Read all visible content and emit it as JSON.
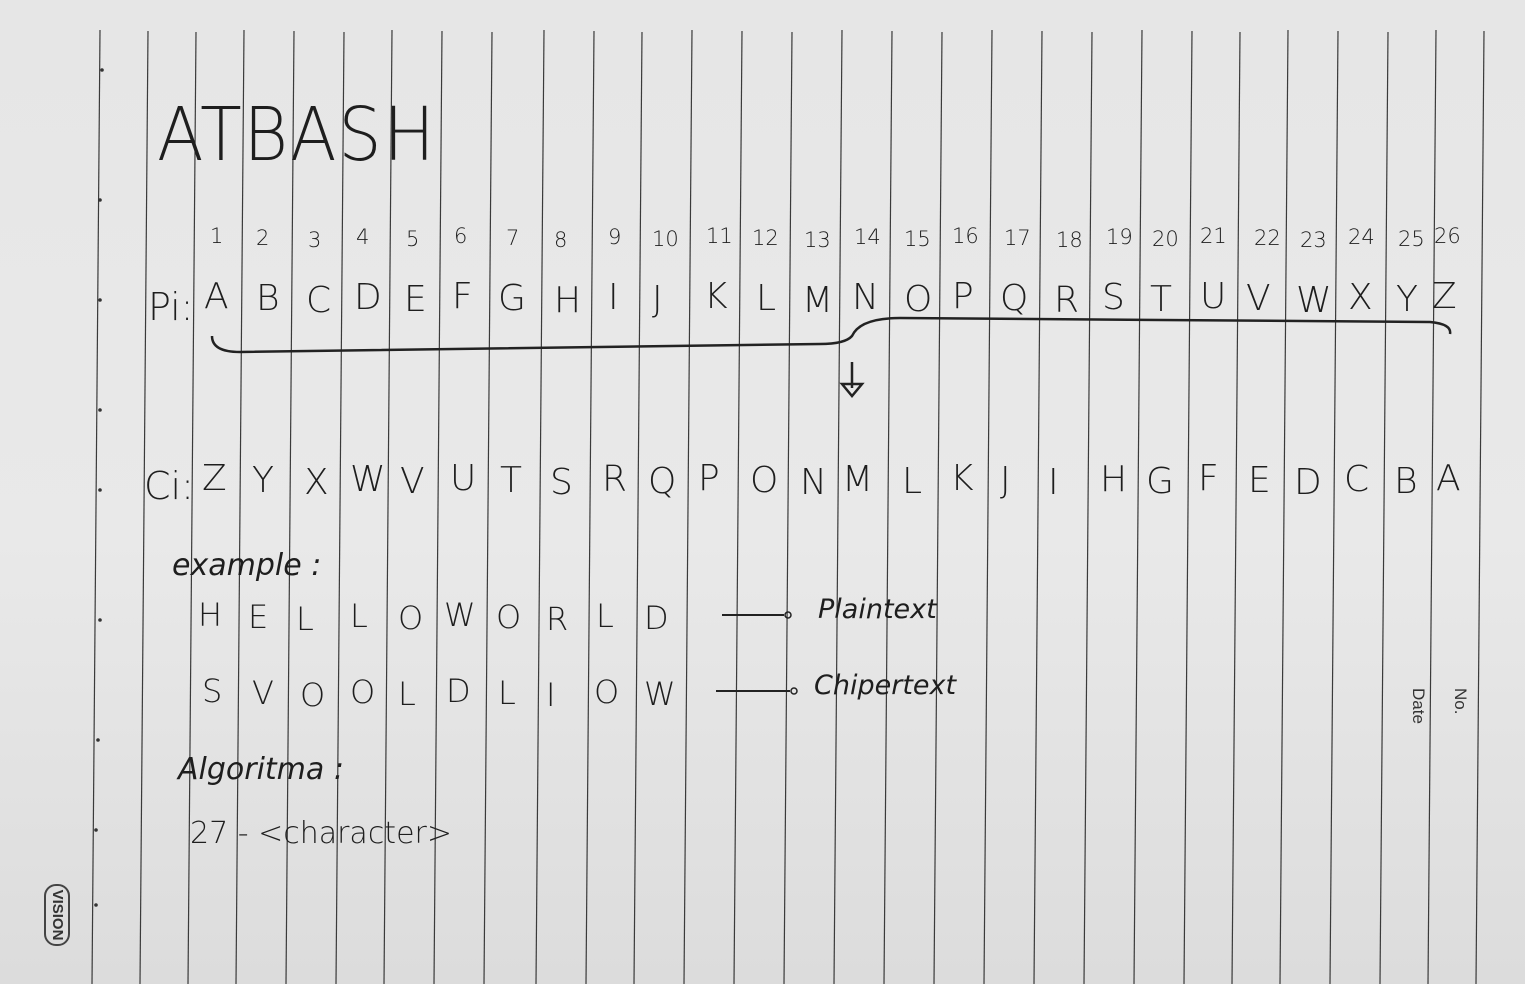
{
  "title": "ATBASH",
  "numbers": [
    "1",
    "2",
    "3",
    "4",
    "5",
    "6",
    "7",
    "8",
    "9",
    "10",
    "11",
    "12",
    "13",
    "14",
    "15",
    "16",
    "17",
    "18",
    "19",
    "20",
    "21",
    "22",
    "23",
    "24",
    "25",
    "26"
  ],
  "plain_label": "Pi:",
  "plain_alphabet": [
    "A",
    "B",
    "C",
    "D",
    "E",
    "F",
    "G",
    "H",
    "I",
    "J",
    "K",
    "L",
    "M",
    "N",
    "O",
    "P",
    "Q",
    "R",
    "S",
    "T",
    "U",
    "V",
    "W",
    "X",
    "Y",
    "Z"
  ],
  "cipher_label": "Ci:",
  "cipher_alphabet": [
    "Z",
    "Y",
    "X",
    "W",
    "V",
    "U",
    "T",
    "S",
    "R",
    "Q",
    "P",
    "O",
    "N",
    "M",
    "L",
    "K",
    "J",
    "I",
    "H",
    "G",
    "F",
    "E",
    "D",
    "C",
    "B",
    "A"
  ],
  "example_label": "example :",
  "plaintext_letters": [
    "H",
    "E",
    "L",
    "L",
    "O",
    "W",
    "O",
    "R",
    "L",
    "D"
  ],
  "plaintext_note": "Plaintext",
  "ciphertext_letters": [
    "S",
    "V",
    "O",
    "O",
    "L",
    "D",
    "L",
    "I",
    "O",
    "W"
  ],
  "ciphertext_note": "Chipertext",
  "algorithm_label": "Algoritma :",
  "formula": "27 - <character>",
  "brand": "VISION",
  "margin_no": "No.",
  "margin_date": "Date"
}
